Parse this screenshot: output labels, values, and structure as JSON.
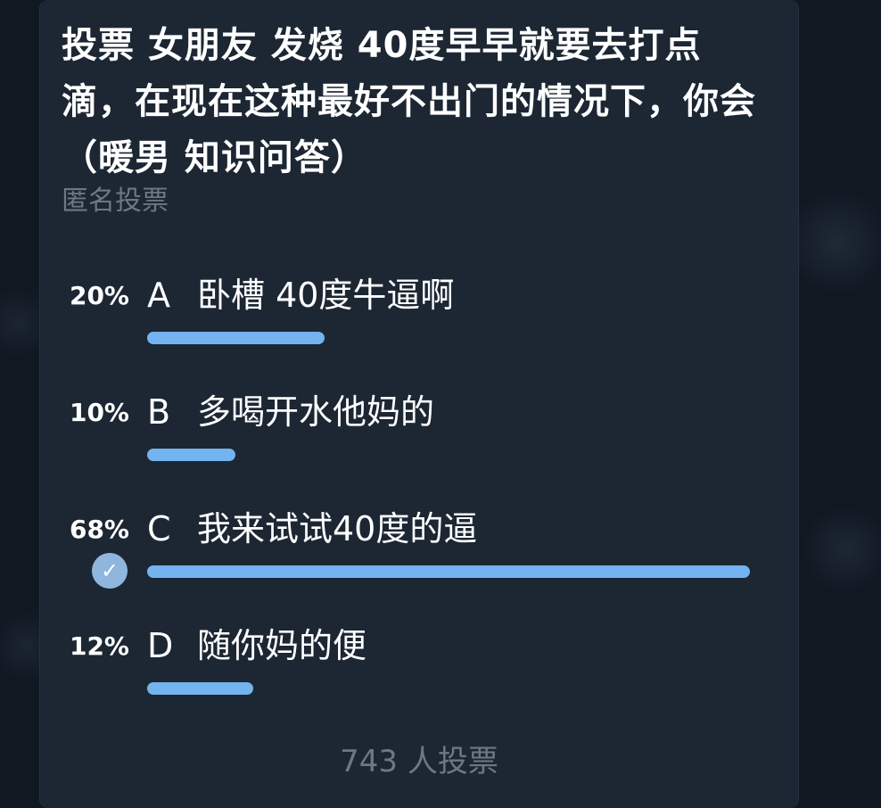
{
  "poll": {
    "question": "投票 女朋友 发烧 40度早早就要去打点滴，在现在这种最好不出门的情况下，你会（暖男 知识问答）",
    "type_label": "匿名投票",
    "options": [
      {
        "percent": "20%",
        "letter": "A",
        "text": "卧槽 40度牛逼啊",
        "fraction": 0.2,
        "chosen": false
      },
      {
        "percent": "10%",
        "letter": "B",
        "text": "多喝开水他妈的",
        "fraction": 0.1,
        "chosen": false
      },
      {
        "percent": "68%",
        "letter": "C",
        "text": "我来试试40度的逼",
        "fraction": 0.68,
        "chosen": true
      },
      {
        "percent": "12%",
        "letter": "D",
        "text": "随你妈的便",
        "fraction": 0.12,
        "chosen": false
      }
    ],
    "voters_label": "743 人投票"
  },
  "colors": {
    "card_background": "#1c2733",
    "bar_fill": "#73b3ef",
    "check_badge": "#8fb6dc",
    "secondary_text": "#6d7883"
  },
  "icons": {
    "chosen_option": "checkmark-icon"
  }
}
